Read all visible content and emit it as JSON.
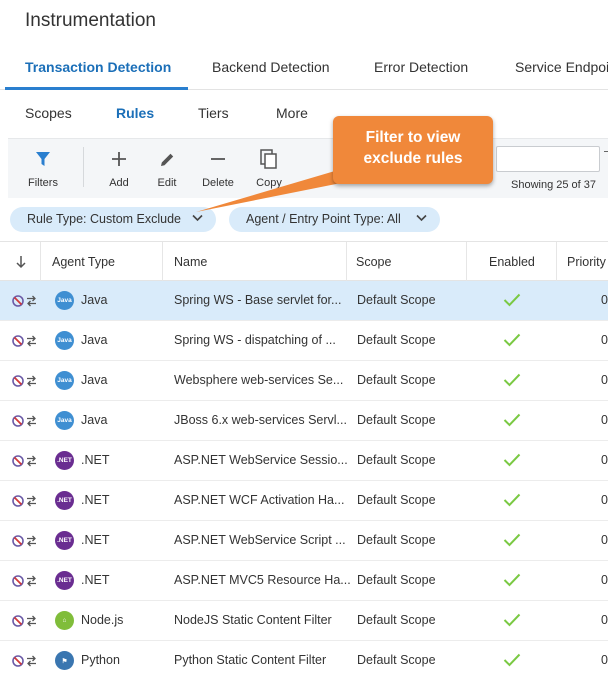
{
  "page": {
    "title": "Instrumentation"
  },
  "tabs": [
    {
      "label": "Transaction Detection",
      "active": true
    },
    {
      "label": "Backend Detection",
      "active": false
    },
    {
      "label": "Error Detection",
      "active": false
    },
    {
      "label": "Service Endpoints",
      "active": false
    }
  ],
  "subtabs": [
    {
      "label": "Scopes",
      "active": false
    },
    {
      "label": "Rules",
      "active": true
    },
    {
      "label": "Tiers",
      "active": false
    },
    {
      "label": "More",
      "active": false
    }
  ],
  "toolbar": {
    "filters_label": "Filters",
    "add_label": "Add",
    "edit_label": "Edit",
    "delete_label": "Delete",
    "copy_label": "Copy",
    "showing_text": "Showing 25 of 37",
    "search_value": ""
  },
  "filters": {
    "rule_type": "Rule Type: Custom Exclude",
    "agent_type": "Agent / Entry Point Type: All"
  },
  "callout": {
    "line1": "Filter to view",
    "line2": "exclude rules"
  },
  "columns": [
    "Agent Type",
    "Name",
    "Scope",
    "Enabled",
    "Priority"
  ],
  "rows": [
    {
      "agent": "Java",
      "agent_icon": "java-icon",
      "name": "Spring WS - Base servlet for...",
      "scope": "Default Scope",
      "enabled": true,
      "priority": "0",
      "selected": true
    },
    {
      "agent": "Java",
      "agent_icon": "java-icon",
      "name": "Spring WS - dispatching of ...",
      "scope": "Default Scope",
      "enabled": true,
      "priority": "0",
      "selected": false
    },
    {
      "agent": "Java",
      "agent_icon": "java-icon",
      "name": "Websphere web-services Se...",
      "scope": "Default Scope",
      "enabled": true,
      "priority": "0",
      "selected": false
    },
    {
      "agent": "Java",
      "agent_icon": "java-icon",
      "name": "JBoss 6.x web-services Servl...",
      "scope": "Default Scope",
      "enabled": true,
      "priority": "0",
      "selected": false
    },
    {
      "agent": ".NET",
      "agent_icon": "dotnet-icon",
      "name": "ASP.NET WebService Sessio...",
      "scope": "Default Scope",
      "enabled": true,
      "priority": "0",
      "selected": false
    },
    {
      "agent": ".NET",
      "agent_icon": "dotnet-icon",
      "name": "ASP.NET WCF Activation Ha...",
      "scope": "Default Scope",
      "enabled": true,
      "priority": "0",
      "selected": false
    },
    {
      "agent": ".NET",
      "agent_icon": "dotnet-icon",
      "name": "ASP.NET WebService Script ...",
      "scope": "Default Scope",
      "enabled": true,
      "priority": "0",
      "selected": false
    },
    {
      "agent": ".NET",
      "agent_icon": "dotnet-icon",
      "name": "ASP.NET MVC5 Resource Ha...",
      "scope": "Default Scope",
      "enabled": true,
      "priority": "0",
      "selected": false
    },
    {
      "agent": "Node.js",
      "agent_icon": "nodejs-icon",
      "name": "NodeJS Static Content Filter",
      "scope": "Default Scope",
      "enabled": true,
      "priority": "0",
      "selected": false
    },
    {
      "agent": "Python",
      "agent_icon": "python-icon",
      "name": "Python Static Content Filter",
      "scope": "Default Scope",
      "enabled": true,
      "priority": "0",
      "selected": false
    }
  ],
  "colors": {
    "accent": "#1b6fb8",
    "selected_row": "#d9ebfa",
    "callout": "#f0883a",
    "check": "#7ac943",
    "java": "#3f8fd2",
    "dotnet": "#6a2d91",
    "nodejs": "#80bd3a",
    "python": "#3a76b0"
  }
}
